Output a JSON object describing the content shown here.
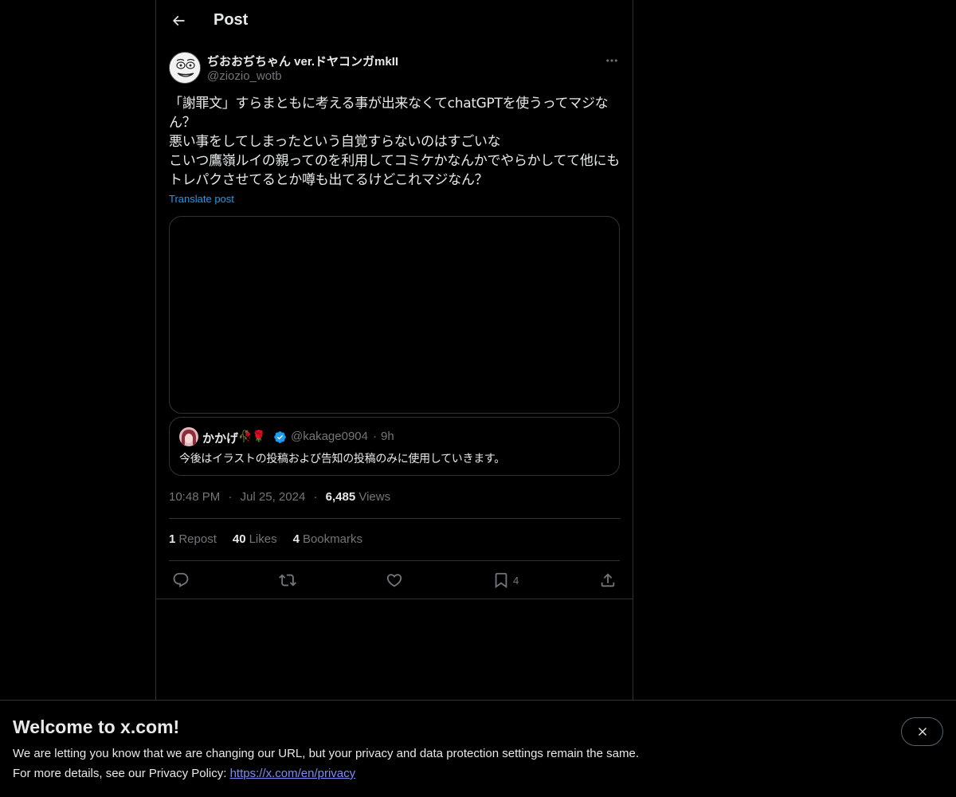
{
  "header": {
    "title": "Post"
  },
  "author": {
    "name": "ぢおおぢちゃん ver.ドヤコンガmkII",
    "handle": "@ziozio_wotb"
  },
  "post": {
    "text": "「謝罪文」すらまともに考える事が出来なくてchatGPTを使うってマジなん？\n悪い事をしてしまったという自覚すらないのはすごいな\nこいつ鷹嶺ルイの親ってのを利用してコミケかなんかでやらかしてて他にもトレパクさせてるとか噂も出てるけどこれマジなん？",
    "translate_label": "Translate post"
  },
  "quote": {
    "name": "かかげ",
    "emoji": "🥀🌹",
    "handle": "@kakage0904",
    "separator": "·",
    "time": "9h",
    "text": "今後はイラストの投稿および告知の投稿のみに使用していきます。"
  },
  "meta": {
    "time": "10:48 PM",
    "sep1": "·",
    "date": "Jul 25, 2024",
    "sep2": "·",
    "views_count": "6,485",
    "views_label": "Views"
  },
  "stats": {
    "reposts_count": "1",
    "reposts_label": "Repost",
    "likes_count": "40",
    "likes_label": "Likes",
    "bookmarks_count": "4",
    "bookmarks_label": "Bookmarks"
  },
  "actions": {
    "bookmark_count": "4"
  },
  "banner": {
    "title": "Welcome to x.com!",
    "line1": "We are letting you know that we are changing our URL, but your privacy and data protection settings remain the same.",
    "line2_prefix": "For more details, see our Privacy Policy: ",
    "link": "https://x.com/en/privacy"
  },
  "colors": {
    "background": "#000000",
    "text": "#e7e9ea",
    "muted": "#71767b",
    "accent": "#1d9bf0",
    "border": "#2f3336"
  },
  "icons": [
    "back-arrow-icon",
    "more-icon",
    "verified-badge-icon",
    "reply-icon",
    "repost-icon",
    "like-icon",
    "bookmark-icon",
    "share-icon",
    "close-icon"
  ]
}
